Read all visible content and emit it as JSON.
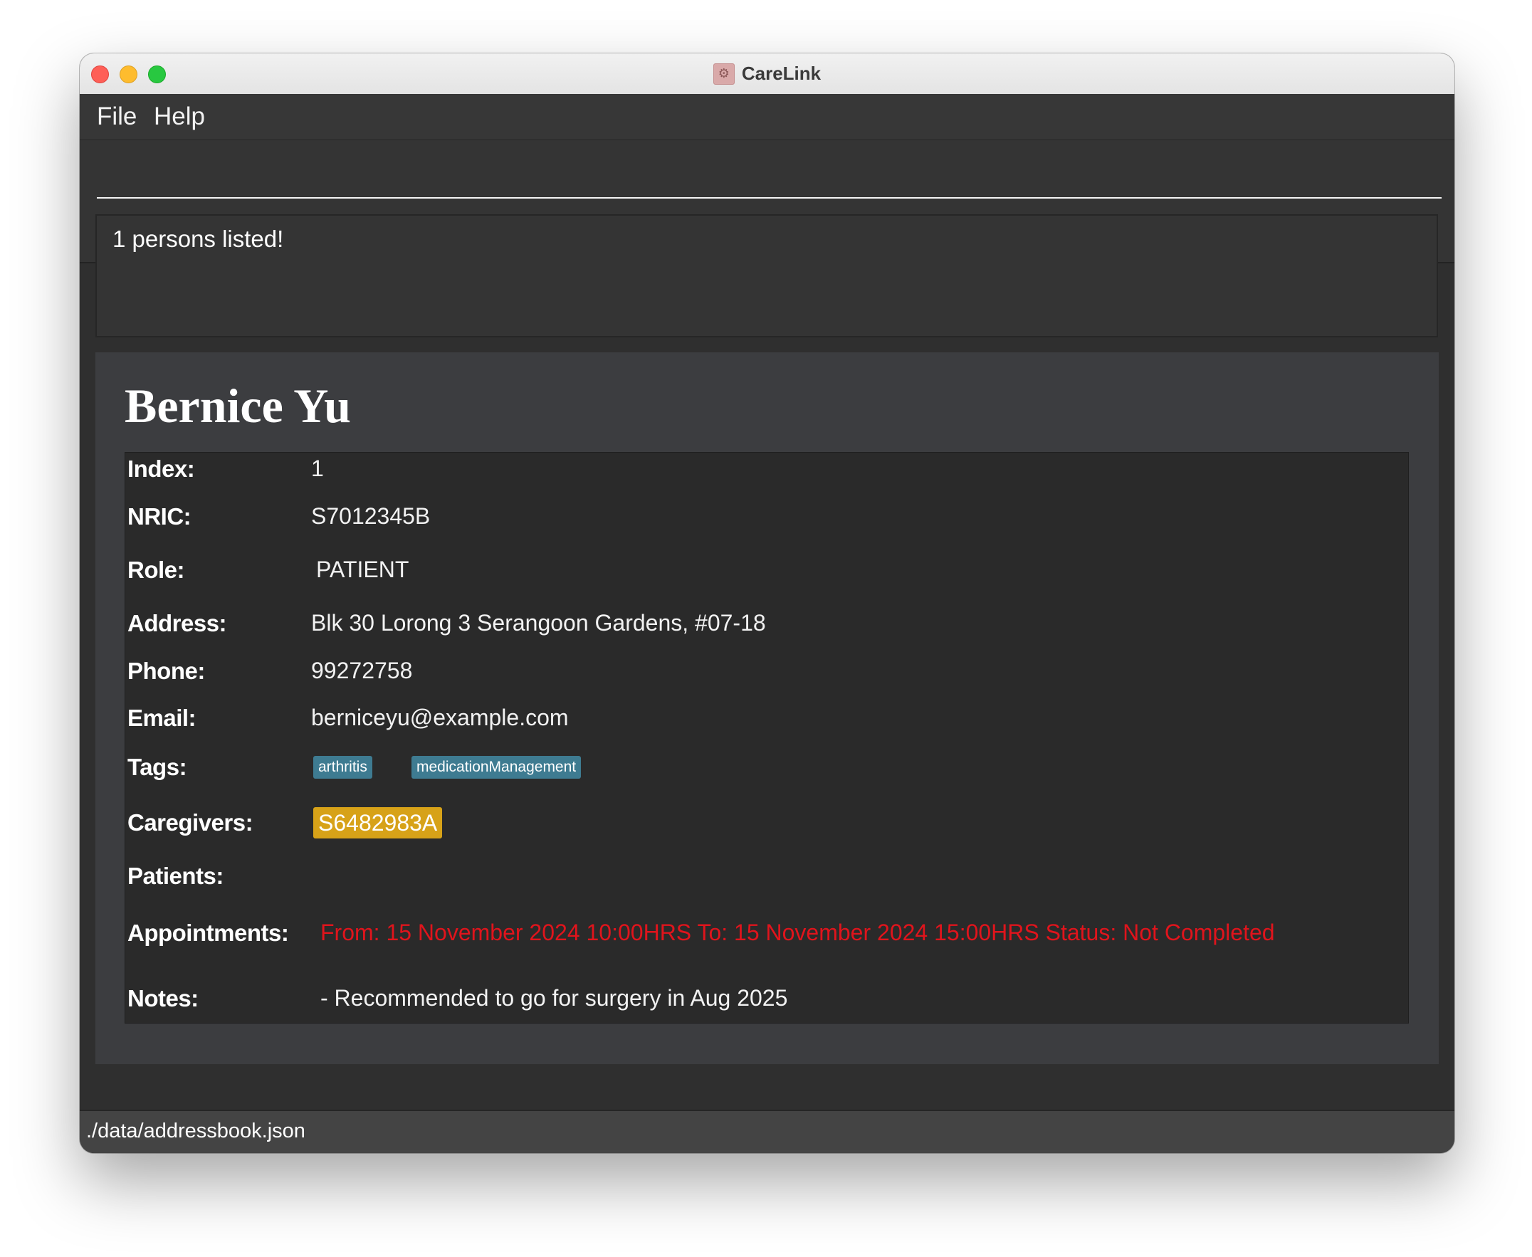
{
  "window": {
    "title": "CareLink"
  },
  "menu": {
    "file": "File",
    "help": "Help"
  },
  "command": {
    "value": "",
    "placeholder": ""
  },
  "result": {
    "message": "1 persons listed!"
  },
  "person": {
    "name": "Bernice Yu",
    "labels": {
      "index": "Index:",
      "nric": "NRIC:",
      "role": "Role:",
      "address": "Address:",
      "phone": "Phone:",
      "email": "Email:",
      "tags": "Tags:",
      "caregivers": "Caregivers:",
      "patients": "Patients:",
      "appointments": "Appointments:",
      "notes": "Notes:"
    },
    "index": "1",
    "nric": "S7012345B",
    "role": "PATIENT",
    "address": "Blk 30 Lorong 3 Serangoon Gardens, #07-18",
    "phone": "99272758",
    "email": "berniceyu@example.com",
    "tags": [
      "arthritis",
      "medicationManagement"
    ],
    "caregivers": [
      "S6482983A"
    ],
    "patients": [],
    "appointment": "From: 15 November 2024 10:00HRS To: 15 November 2024 15:00HRS Status: Not Completed",
    "notes": "- Recommended to go for surgery in Aug 2025"
  },
  "colors": {
    "tag_bg": "#3e7b91",
    "caregiver_bg": "#d7a218",
    "appointment_text": "#e0141c",
    "panel_bg": "#2a2a2a"
  },
  "status_bar": {
    "path": "./data/addressbook.json"
  }
}
